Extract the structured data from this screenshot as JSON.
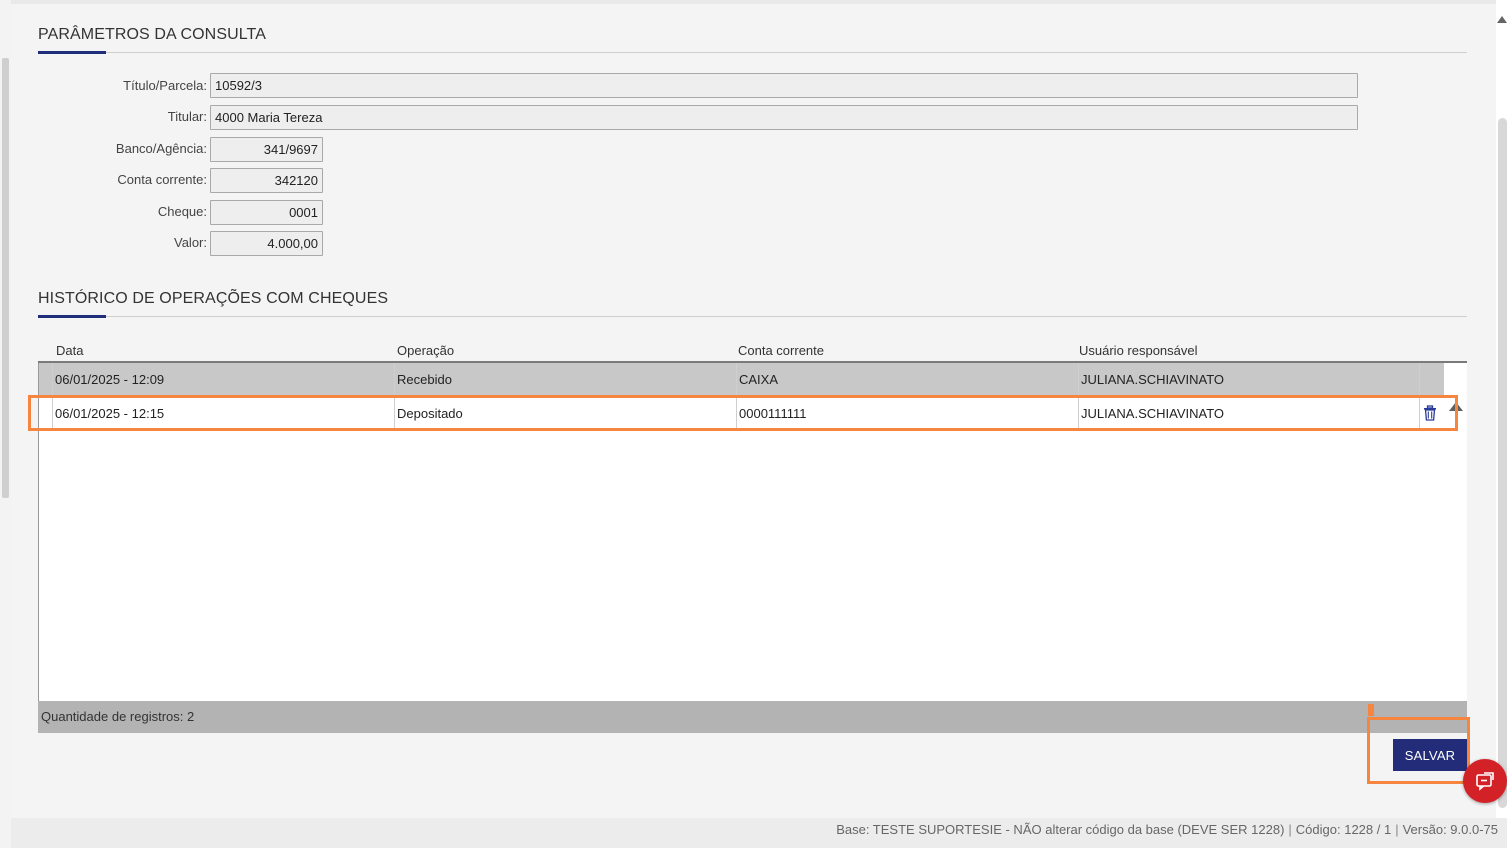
{
  "params_section": {
    "title": "PARÂMETROS DA CONSULTA",
    "fields": [
      {
        "label": "Título/Parcela:",
        "value": "10592/3"
      },
      {
        "label": "Titular:",
        "value": "4000 Maria Tereza"
      },
      {
        "label": "Banco/Agência:",
        "value": "341/9697"
      },
      {
        "label": "Conta corrente:",
        "value": "342120"
      },
      {
        "label": "Cheque:",
        "value": "0001"
      },
      {
        "label": "Valor:",
        "value": "4.000,00"
      }
    ]
  },
  "history_section": {
    "title": "HISTÓRICO DE OPERAÇÕES COM CHEQUES",
    "columns": [
      "Data",
      "Operação",
      "Conta corrente",
      "Usuário responsável"
    ],
    "rows": [
      {
        "data": "06/01/2025 - 12:09",
        "operacao": "Recebido",
        "conta": "CAIXA",
        "usuario": "JULIANA.SCHIAVINATO",
        "selected": true
      },
      {
        "data": "06/01/2025 - 12:15",
        "operacao": "Depositado",
        "conta": "0000111111",
        "usuario": "JULIANA.SCHIAVINATO",
        "selected": false
      }
    ],
    "record_count_label": "Quantidade de registros: 2"
  },
  "actions": {
    "save_label": "SALVAR"
  },
  "status_bar": {
    "base": "Base: TESTE SUPORTESIE - NÃO alterar código da base (DEVE SER 1228)",
    "codigo": "Código: 1228 / 1",
    "versao": "Versão: 9.0.0-75"
  },
  "colors": {
    "accent": "#1f2d7a",
    "save_button": "#222c78",
    "highlight": "#f5853f",
    "chat_button": "#d32128",
    "selected_row": "#c8c8c8"
  },
  "icons": {
    "trash": "trash-icon",
    "chat": "chat-icon",
    "scroll_up": "scroll-up-icon",
    "scroll_down": "scroll-down-icon"
  }
}
